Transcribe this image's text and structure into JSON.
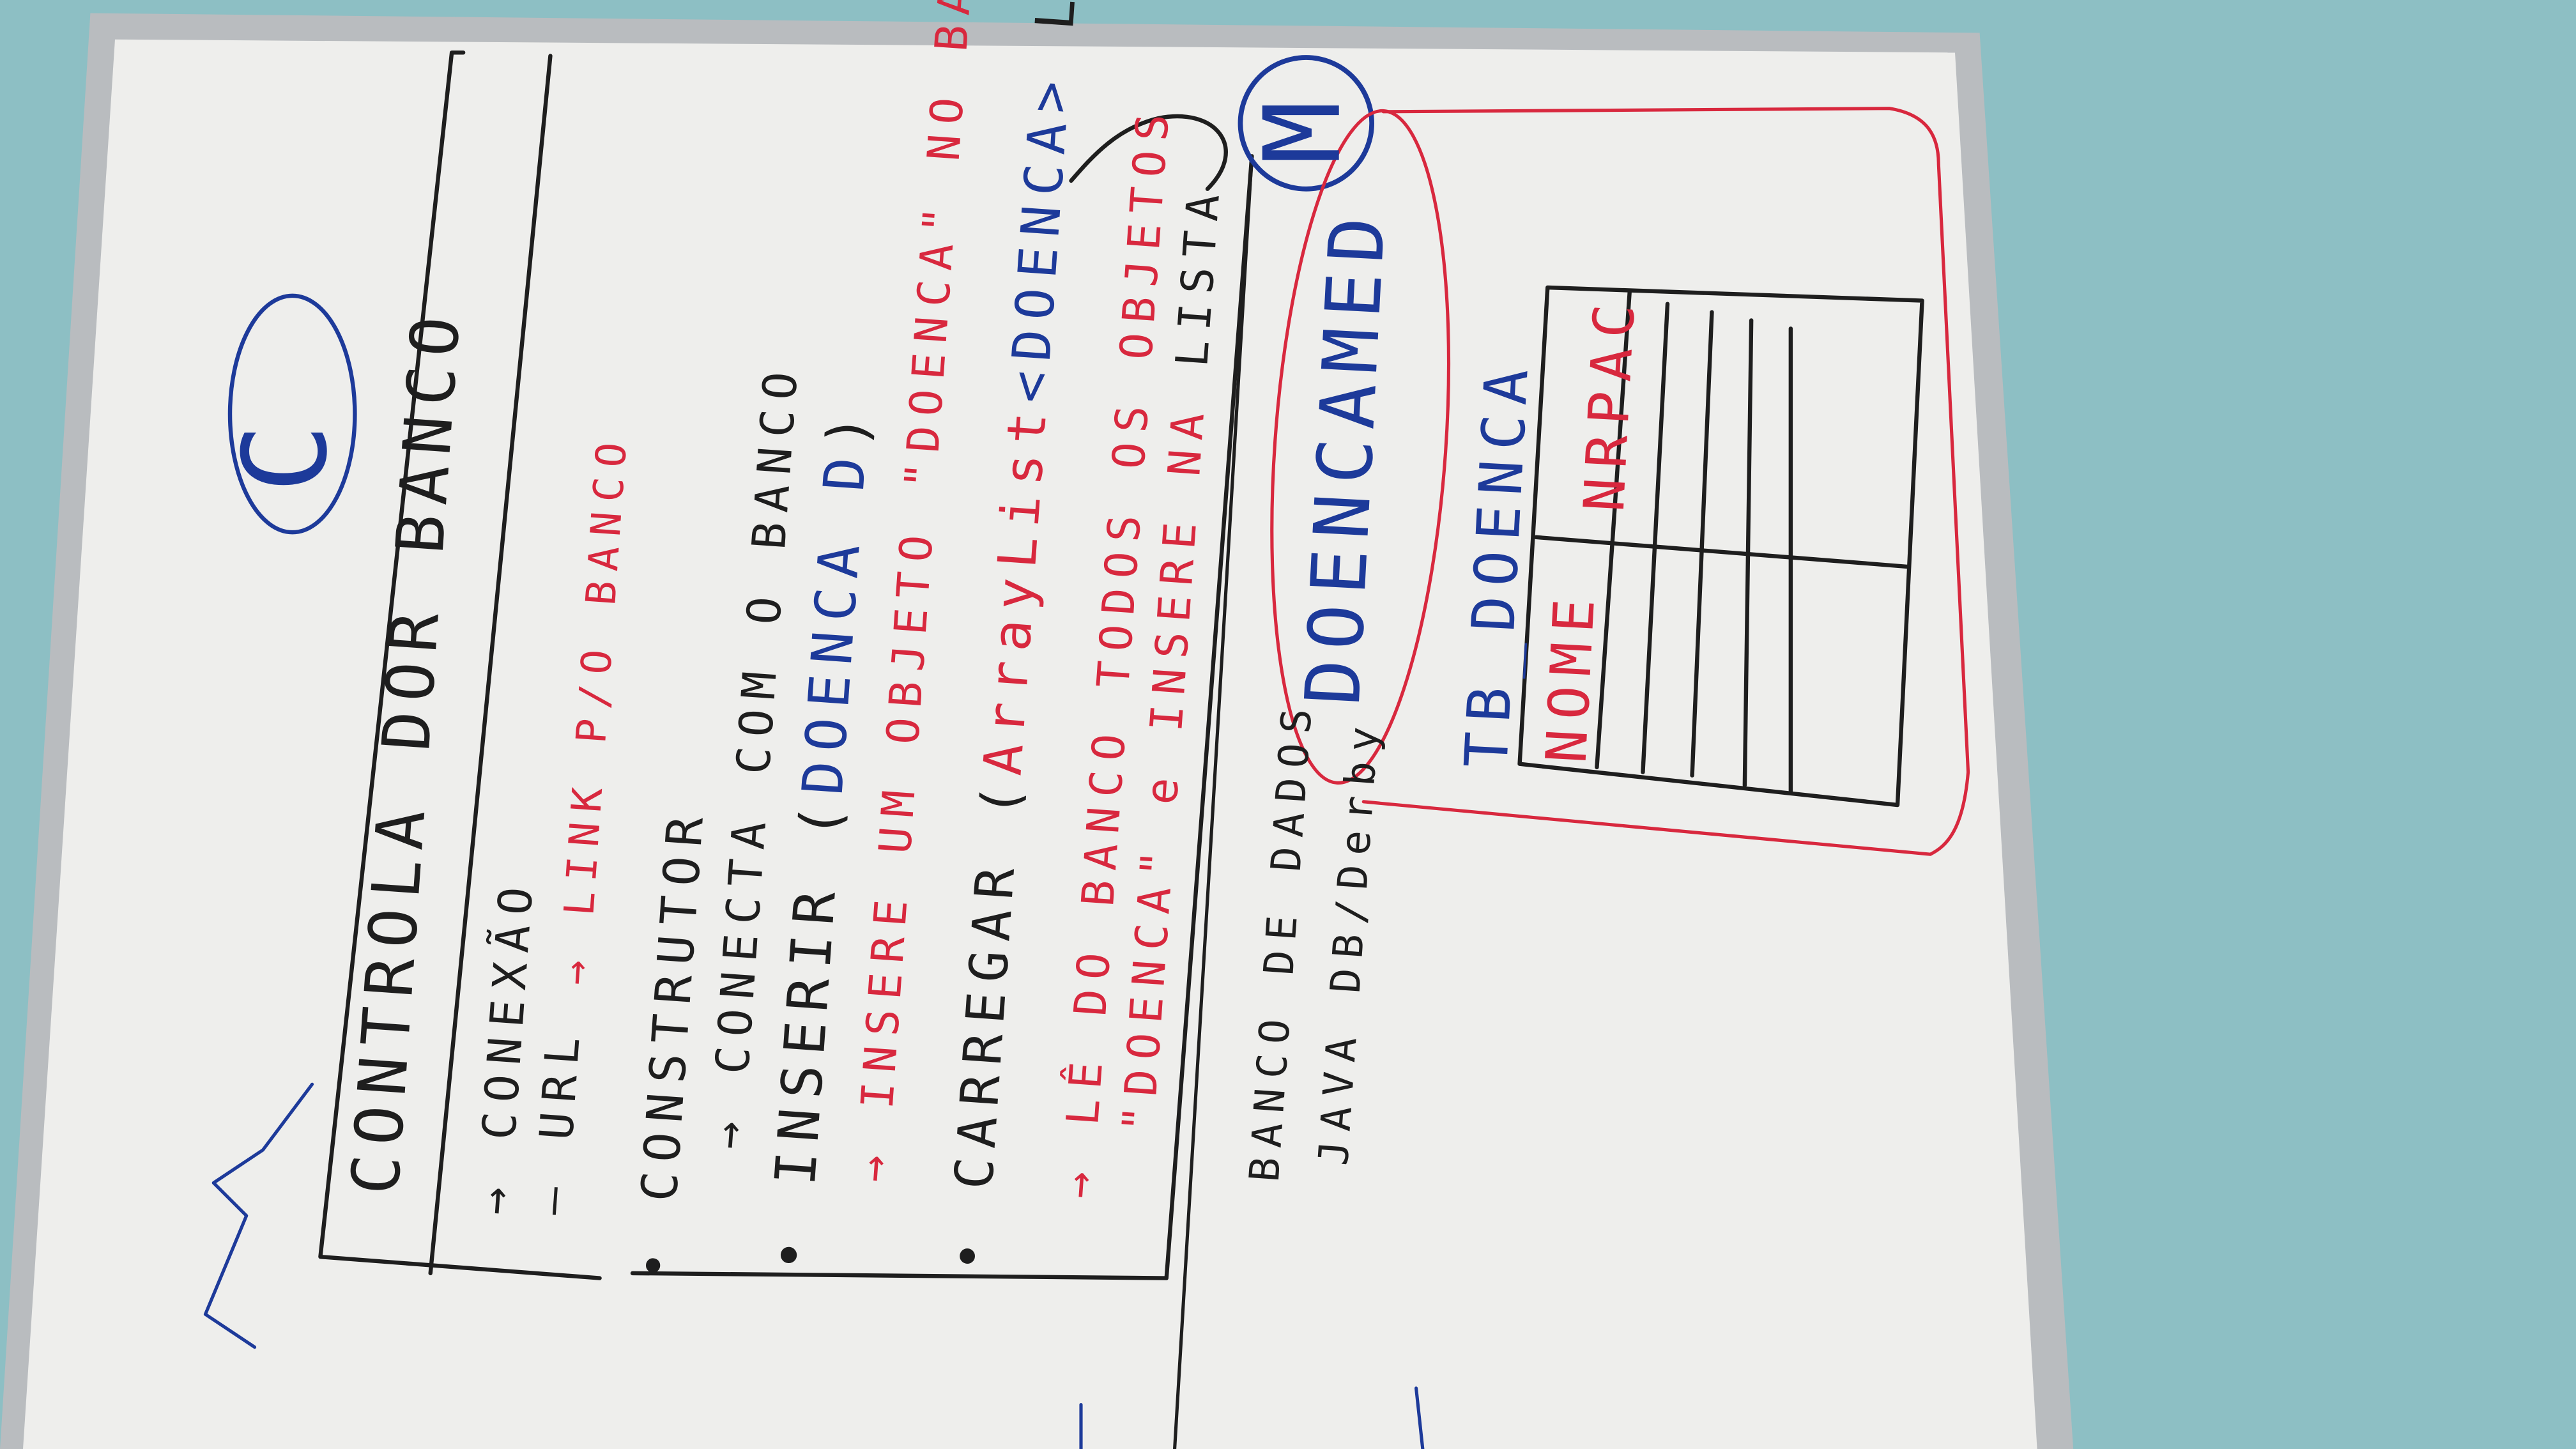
{
  "colors": {
    "wall": "#8dbfc4",
    "board": "#eeeeec",
    "frame": "#b9bcbf",
    "black_marker": "#1e1e1e",
    "red_marker": "#d8283e",
    "blue_marker": "#1d3a9a"
  },
  "controller": {
    "circle_letter": "C",
    "title": "CONTROLA DOR BANCO",
    "conexao": "→ CONEXÃO",
    "url": "— URL",
    "url_note": "→ LINK P/O BANCO",
    "construtor": "• CONSTRUTOR",
    "construtor_note": "→ CONECTA COM O BANCO",
    "inserir": "• INSERIR (",
    "inserir_param": "DOENCA D",
    "inserir_close": ")",
    "inserir_note": "→ INSERE UM OBJETO \"DOENCA\" NO BANCO",
    "carregar": "• CARREGAR (",
    "carregar_type": "ArrayList",
    "carregar_generic": "<DOENCA>",
    "carregar_close": " LISTA)?",
    "carregar_note_1": "→ LÊ DO BANCO TODOS OS OBJETOS",
    "carregar_note_2": "\"DOENCA\" e INSERE NA",
    "carregar_note_2_end": " LISTA"
  },
  "database": {
    "circle_letter": "M",
    "label_1": "BANCO DE DADOS",
    "label_2": "JAVA DB/Derby",
    "name": "DOENCAMED",
    "table_name": "TB_DOENCA",
    "columns": [
      "NOME",
      "NRPAC"
    ]
  }
}
